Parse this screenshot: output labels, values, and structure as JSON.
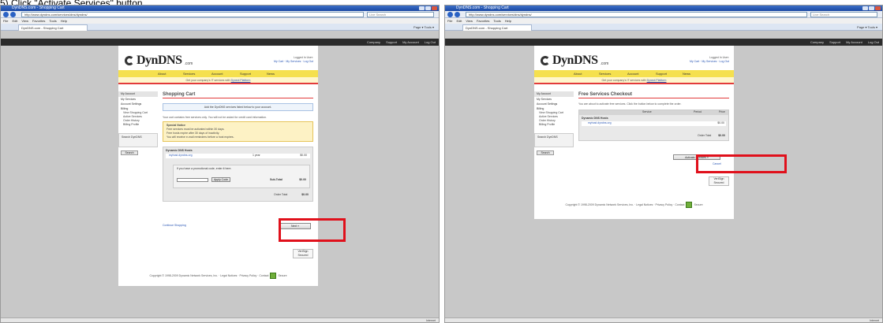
{
  "caption": "5) Click \"Activate Services\" button",
  "browser": {
    "address": "http://www.dyndns.com/services/dns/dyndns/",
    "menu": [
      "File",
      "Edit",
      "View",
      "Favorites",
      "Tools",
      "Help"
    ],
    "tab": "DynDNS.com - Shopping Cart",
    "tools": "Page ▾ Tools ▾",
    "search_placeholder": "Live Search",
    "status": "Internet"
  },
  "site": {
    "top_links": [
      "Company",
      "Support",
      "My Account",
      "Log Out"
    ],
    "logo": "DynDNS",
    "logo_sub": ".com",
    "account_line1": "Logged In User:",
    "account_line2": "My Cart · My Services · Log Out",
    "nav": [
      "About",
      "Services",
      "Account",
      "Support",
      "News"
    ],
    "notice_text": "Get your company's IT services with",
    "notice_link": "Dynect Platform",
    "sidebar": {
      "head": "My Account",
      "items": [
        "My Services",
        "Account Settings",
        "Billing"
      ],
      "sub": [
        "View Shopping Cart",
        "Active Services",
        "Order History",
        "Billing Profile"
      ],
      "search_head": "Search DynDNS",
      "search_btn": "Search"
    },
    "footer": "Copyright © 1998-2009 Dynamic Network Services, Inc. · Legal Notices · Privacy Policy · Contact",
    "footer_badge": "Secure"
  },
  "left": {
    "title": "Shopping Cart",
    "info": "Add the DynDNS services listed below to your account.",
    "intro": "Your cart contains free services only. You will not be asked for credit card information.",
    "warn_title": "Special Notice",
    "warn_lines": [
      "Free services must be activated within 30 days.",
      "Free hosts expire after 30 days of inactivity.",
      "You will receive e-mail reminders before a host expires."
    ],
    "section": "Dynamic DNS Hosts",
    "item": "myhost.dyndns.org",
    "item_period": "1 year",
    "item_price": "$0.00",
    "promo_text": "If you have a promotional code, enter it here.",
    "promo_btn": "Apply Code",
    "subtotal_label": "Sub-Total",
    "subtotal": "$0.00",
    "total_label": "Order Total",
    "total": "$0.00",
    "next_btn": "Next »",
    "continue_link": "Continue Shopping",
    "cards": "VeriSign Secured"
  },
  "right": {
    "title": "Free Services Checkout",
    "intro": "You are about to activate free services. Click the button below to complete the order.",
    "col_service": "Service",
    "col_period": "Period",
    "col_price": "Price",
    "section": "Dynamic DNS Hosts",
    "item": "myhost.dyndns.org",
    "item_price": "$0.00",
    "total_label": "Order Total",
    "total": "$0.00",
    "activate_btn": "Activate Services »",
    "cancel_link": "Cancel",
    "cards": "VeriSign Secured"
  }
}
